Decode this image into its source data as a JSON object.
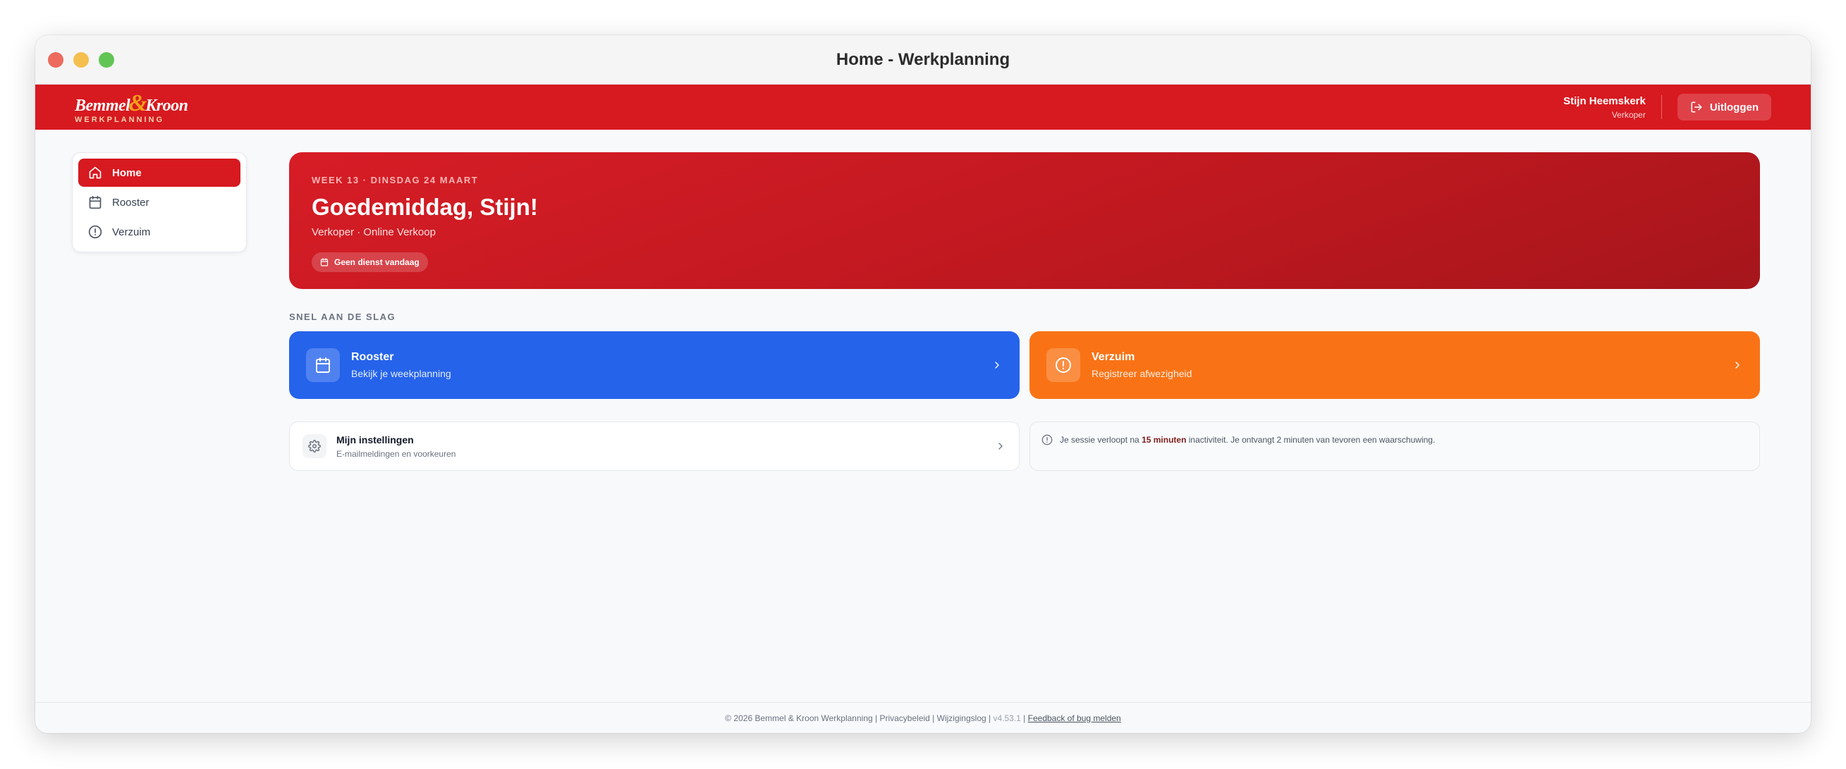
{
  "window": {
    "title": "Home - Werkplanning"
  },
  "header": {
    "logo_left": "Bemmel",
    "logo_amp": "&",
    "logo_right": "Kroon",
    "logo_sub": "WERKPLANNING",
    "user_name": "Stijn Heemskerk",
    "user_role": "Verkoper",
    "logout_label": "Uitloggen"
  },
  "sidebar": {
    "items": [
      {
        "label": "Home",
        "icon": "home-icon",
        "active": true
      },
      {
        "label": "Rooster",
        "icon": "calendar-icon",
        "active": false
      },
      {
        "label": "Verzuim",
        "icon": "alert-circle-icon",
        "active": false
      }
    ]
  },
  "hero": {
    "week": "WEEK 13 · DINSDAG 24 MAART",
    "greeting": "Goedemiddag, Stijn!",
    "subtitle": "Verkoper · Online Verkoop",
    "badge": "Geen dienst vandaag"
  },
  "quick": {
    "label": "SNEL AAN DE SLAG",
    "rooster": {
      "title": "Rooster",
      "subtitle": "Bekijk je weekplanning"
    },
    "verzuim": {
      "title": "Verzuim",
      "subtitle": "Registreer afwezigheid"
    }
  },
  "settings": {
    "title": "Mijn instellingen",
    "subtitle": "E-mailmeldingen en voorkeuren"
  },
  "session": {
    "text_before": "Je sessie verloopt na ",
    "duration": "15 minuten",
    "text_after": " inactiviteit. Je ontvangt 2 minuten van tevoren een waarschuwing."
  },
  "footer": {
    "copyright": "© 2026 Bemmel & Kroon Werkplanning",
    "privacy": "Privacybeleid",
    "changelog": "Wijzigingslog",
    "version": "v4.53.1",
    "feedback": "Feedback of bug melden"
  },
  "colors": {
    "brand_red": "#d71920",
    "rooster_blue": "#2563eb",
    "verzuim_orange": "#f97316"
  }
}
